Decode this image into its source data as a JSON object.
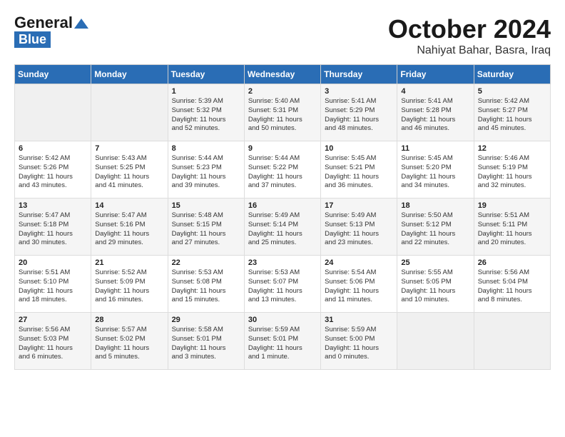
{
  "header": {
    "logo_line1": "General",
    "logo_line2": "Blue",
    "month": "October 2024",
    "location": "Nahiyat Bahar, Basra, Iraq"
  },
  "days_of_week": [
    "Sunday",
    "Monday",
    "Tuesday",
    "Wednesday",
    "Thursday",
    "Friday",
    "Saturday"
  ],
  "weeks": [
    [
      {
        "day": "",
        "info": ""
      },
      {
        "day": "",
        "info": ""
      },
      {
        "day": "1",
        "info": "Sunrise: 5:39 AM\nSunset: 5:32 PM\nDaylight: 11 hours\nand 52 minutes."
      },
      {
        "day": "2",
        "info": "Sunrise: 5:40 AM\nSunset: 5:31 PM\nDaylight: 11 hours\nand 50 minutes."
      },
      {
        "day": "3",
        "info": "Sunrise: 5:41 AM\nSunset: 5:29 PM\nDaylight: 11 hours\nand 48 minutes."
      },
      {
        "day": "4",
        "info": "Sunrise: 5:41 AM\nSunset: 5:28 PM\nDaylight: 11 hours\nand 46 minutes."
      },
      {
        "day": "5",
        "info": "Sunrise: 5:42 AM\nSunset: 5:27 PM\nDaylight: 11 hours\nand 45 minutes."
      }
    ],
    [
      {
        "day": "6",
        "info": "Sunrise: 5:42 AM\nSunset: 5:26 PM\nDaylight: 11 hours\nand 43 minutes."
      },
      {
        "day": "7",
        "info": "Sunrise: 5:43 AM\nSunset: 5:25 PM\nDaylight: 11 hours\nand 41 minutes."
      },
      {
        "day": "8",
        "info": "Sunrise: 5:44 AM\nSunset: 5:23 PM\nDaylight: 11 hours\nand 39 minutes."
      },
      {
        "day": "9",
        "info": "Sunrise: 5:44 AM\nSunset: 5:22 PM\nDaylight: 11 hours\nand 37 minutes."
      },
      {
        "day": "10",
        "info": "Sunrise: 5:45 AM\nSunset: 5:21 PM\nDaylight: 11 hours\nand 36 minutes."
      },
      {
        "day": "11",
        "info": "Sunrise: 5:45 AM\nSunset: 5:20 PM\nDaylight: 11 hours\nand 34 minutes."
      },
      {
        "day": "12",
        "info": "Sunrise: 5:46 AM\nSunset: 5:19 PM\nDaylight: 11 hours\nand 32 minutes."
      }
    ],
    [
      {
        "day": "13",
        "info": "Sunrise: 5:47 AM\nSunset: 5:18 PM\nDaylight: 11 hours\nand 30 minutes."
      },
      {
        "day": "14",
        "info": "Sunrise: 5:47 AM\nSunset: 5:16 PM\nDaylight: 11 hours\nand 29 minutes."
      },
      {
        "day": "15",
        "info": "Sunrise: 5:48 AM\nSunset: 5:15 PM\nDaylight: 11 hours\nand 27 minutes."
      },
      {
        "day": "16",
        "info": "Sunrise: 5:49 AM\nSunset: 5:14 PM\nDaylight: 11 hours\nand 25 minutes."
      },
      {
        "day": "17",
        "info": "Sunrise: 5:49 AM\nSunset: 5:13 PM\nDaylight: 11 hours\nand 23 minutes."
      },
      {
        "day": "18",
        "info": "Sunrise: 5:50 AM\nSunset: 5:12 PM\nDaylight: 11 hours\nand 22 minutes."
      },
      {
        "day": "19",
        "info": "Sunrise: 5:51 AM\nSunset: 5:11 PM\nDaylight: 11 hours\nand 20 minutes."
      }
    ],
    [
      {
        "day": "20",
        "info": "Sunrise: 5:51 AM\nSunset: 5:10 PM\nDaylight: 11 hours\nand 18 minutes."
      },
      {
        "day": "21",
        "info": "Sunrise: 5:52 AM\nSunset: 5:09 PM\nDaylight: 11 hours\nand 16 minutes."
      },
      {
        "day": "22",
        "info": "Sunrise: 5:53 AM\nSunset: 5:08 PM\nDaylight: 11 hours\nand 15 minutes."
      },
      {
        "day": "23",
        "info": "Sunrise: 5:53 AM\nSunset: 5:07 PM\nDaylight: 11 hours\nand 13 minutes."
      },
      {
        "day": "24",
        "info": "Sunrise: 5:54 AM\nSunset: 5:06 PM\nDaylight: 11 hours\nand 11 minutes."
      },
      {
        "day": "25",
        "info": "Sunrise: 5:55 AM\nSunset: 5:05 PM\nDaylight: 11 hours\nand 10 minutes."
      },
      {
        "day": "26",
        "info": "Sunrise: 5:56 AM\nSunset: 5:04 PM\nDaylight: 11 hours\nand 8 minutes."
      }
    ],
    [
      {
        "day": "27",
        "info": "Sunrise: 5:56 AM\nSunset: 5:03 PM\nDaylight: 11 hours\nand 6 minutes."
      },
      {
        "day": "28",
        "info": "Sunrise: 5:57 AM\nSunset: 5:02 PM\nDaylight: 11 hours\nand 5 minutes."
      },
      {
        "day": "29",
        "info": "Sunrise: 5:58 AM\nSunset: 5:01 PM\nDaylight: 11 hours\nand 3 minutes."
      },
      {
        "day": "30",
        "info": "Sunrise: 5:59 AM\nSunset: 5:01 PM\nDaylight: 11 hours\nand 1 minute."
      },
      {
        "day": "31",
        "info": "Sunrise: 5:59 AM\nSunset: 5:00 PM\nDaylight: 11 hours\nand 0 minutes."
      },
      {
        "day": "",
        "info": ""
      },
      {
        "day": "",
        "info": ""
      }
    ]
  ]
}
